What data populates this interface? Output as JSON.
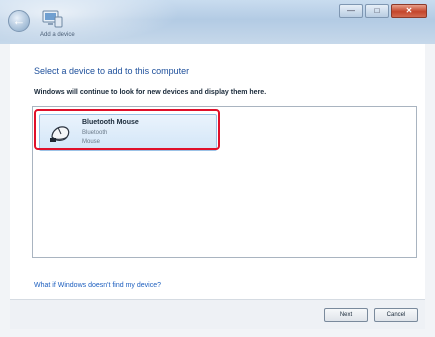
{
  "window": {
    "title": "Add a device",
    "back_glyph": "←",
    "minimize_glyph": "—",
    "maximize_glyph": "□",
    "close_glyph": "✕",
    "icons": {
      "back": "back-arrow-icon",
      "app": "devices-icon",
      "close": "close-icon"
    }
  },
  "main": {
    "heading": "Select a device to add to this computer",
    "subheading": "Windows will continue to look for new devices and display them here.",
    "devices": [
      {
        "name": "Bluetooth Mouse",
        "type": "Bluetooth",
        "kind": "Mouse",
        "icon": "mouse-icon",
        "selected": true
      }
    ],
    "help_link": "What if Windows doesn't find my device?"
  },
  "footer": {
    "next_label": "Next",
    "cancel_label": "Cancel"
  },
  "colors": {
    "heading": "#1d4f9b",
    "link": "#1d5fbf",
    "highlight_box": "#e0102a",
    "selection": "#d3e6f8"
  }
}
